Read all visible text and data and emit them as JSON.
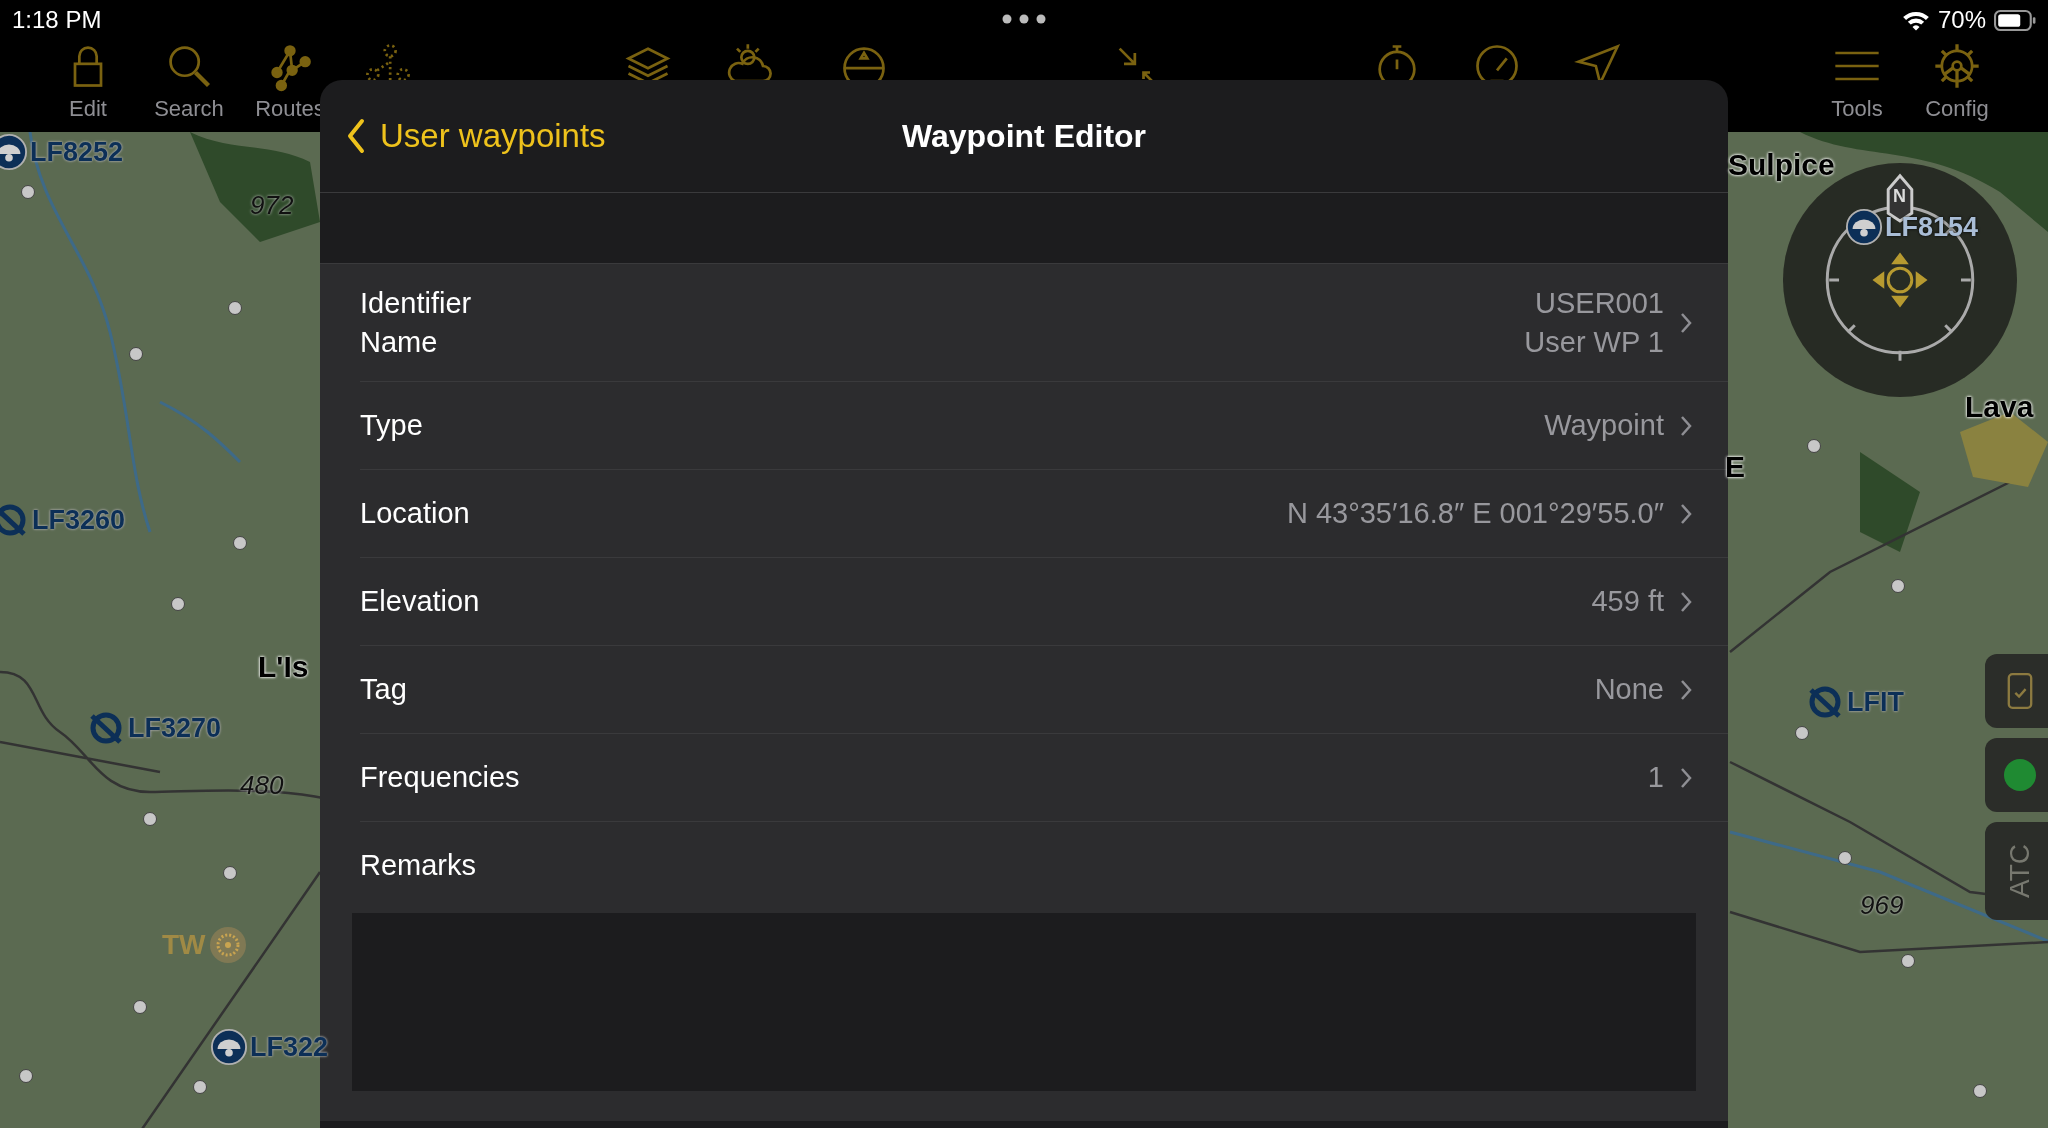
{
  "status_bar": {
    "time": "1:18 PM",
    "battery": "70%"
  },
  "toolbar": [
    {
      "kind": "lock",
      "label": "Edit"
    },
    {
      "kind": "search",
      "label": "Search"
    },
    {
      "kind": "routes",
      "label": "Routes"
    },
    {
      "kind": "dotted-routes"
    },
    {
      "kind": "layers"
    },
    {
      "kind": "weather"
    },
    {
      "kind": "attitude"
    },
    {
      "kind": "arrows"
    },
    {
      "kind": "stopwatch"
    },
    {
      "kind": "speedometer"
    },
    {
      "kind": "send"
    },
    {
      "kind": "menu",
      "label": "Tools"
    },
    {
      "kind": "gear",
      "label": "Config"
    }
  ],
  "map": {
    "labels": [
      {
        "kind": "airport-dome",
        "text": "LF8252"
      },
      {
        "kind": "elevation",
        "text": "972"
      },
      {
        "kind": "airport-slash",
        "text": "LF3260"
      },
      {
        "kind": "town",
        "text": "L'Is"
      },
      {
        "kind": "airport-slash",
        "text": "LF3270"
      },
      {
        "kind": "elevation",
        "text": "480"
      },
      {
        "kind": "reporting",
        "text": "TW"
      },
      {
        "kind": "airport-dome",
        "text": "LF322"
      },
      {
        "kind": "town",
        "text": "Sulpice"
      },
      {
        "kind": "airport-dome",
        "text": "LF8154"
      },
      {
        "kind": "town",
        "text": "Lava"
      },
      {
        "kind": "town",
        "text": "E"
      },
      {
        "kind": "airport-slash",
        "text": "LFIT"
      },
      {
        "kind": "elevation",
        "text": "969"
      }
    ],
    "compass": {
      "north_label": "N"
    },
    "side_buttons": [
      {
        "kind": "checklist"
      },
      {
        "kind": "status",
        "color": "#1f8a32"
      },
      {
        "kind": "text",
        "label": "ATC"
      }
    ]
  },
  "editor": {
    "back_label": "User waypoints",
    "title": "Waypoint Editor",
    "rows": [
      {
        "labels": [
          "Identifier",
          "Name"
        ],
        "values": [
          "USER001",
          "User WP 1"
        ]
      },
      {
        "labels": [
          "Type"
        ],
        "values": [
          "Waypoint"
        ]
      },
      {
        "labels": [
          "Location"
        ],
        "values": [
          "N 43°35′16.8″ E 001°29′55.0″"
        ]
      },
      {
        "labels": [
          "Elevation"
        ],
        "values": [
          "459 ft"
        ]
      },
      {
        "labels": [
          "Tag"
        ],
        "values": [
          "None"
        ]
      },
      {
        "labels": [
          "Frequencies"
        ],
        "values": [
          "1"
        ]
      }
    ],
    "remarks": {
      "label": "Remarks"
    }
  }
}
